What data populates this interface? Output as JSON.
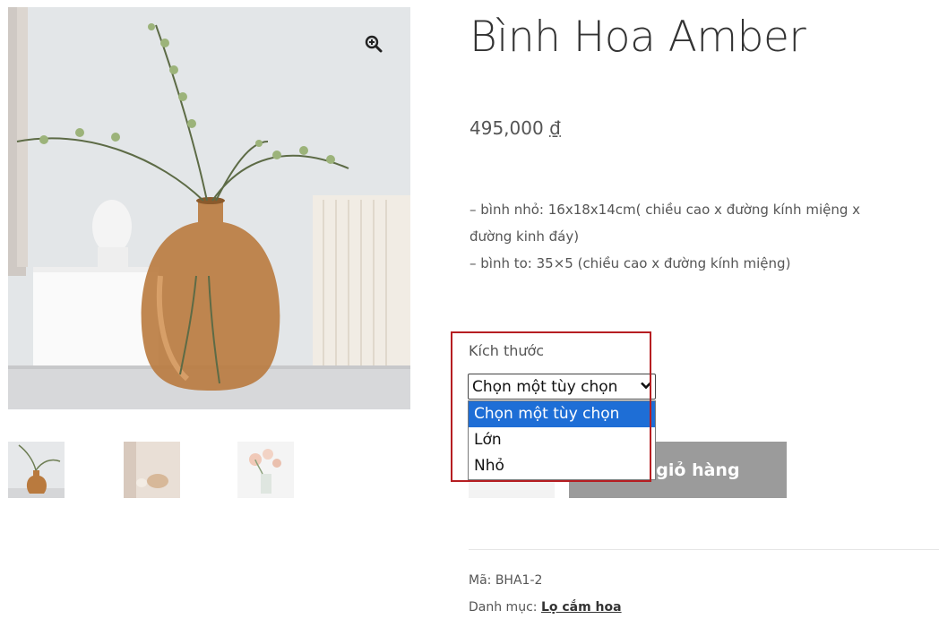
{
  "product": {
    "title": "Bình Hoa Amber",
    "price_amount": "495,000",
    "price_currency": "₫",
    "description": [
      "– bình nhỏ: 16x18x14cm( chiều cao x đường kính miệng x",
      "đường kinh đáy)",
      "– bình to: 35×5 (chiều cao x đường kính miệng)"
    ]
  },
  "variation": {
    "label": "Kích thước",
    "selected": "Chọn một tùy chọn",
    "options": [
      "Chọn một tùy chọn",
      "Lớn",
      "Nhỏ"
    ]
  },
  "cart": {
    "button_label": "vào giỏ hàng"
  },
  "meta": {
    "sku_label": "Mã:",
    "sku_value": "BHA1-2",
    "category_label": "Danh mục:",
    "category_value": "Lọ cắm hoa"
  },
  "icons": {
    "zoom": "magnifier-plus-icon",
    "select_arrow": "chevron-down-icon"
  },
  "colors": {
    "highlight_border": "#b61e22",
    "option_selected_bg": "#1e6ed6",
    "cart_button_bg": "#9b9b9b"
  }
}
